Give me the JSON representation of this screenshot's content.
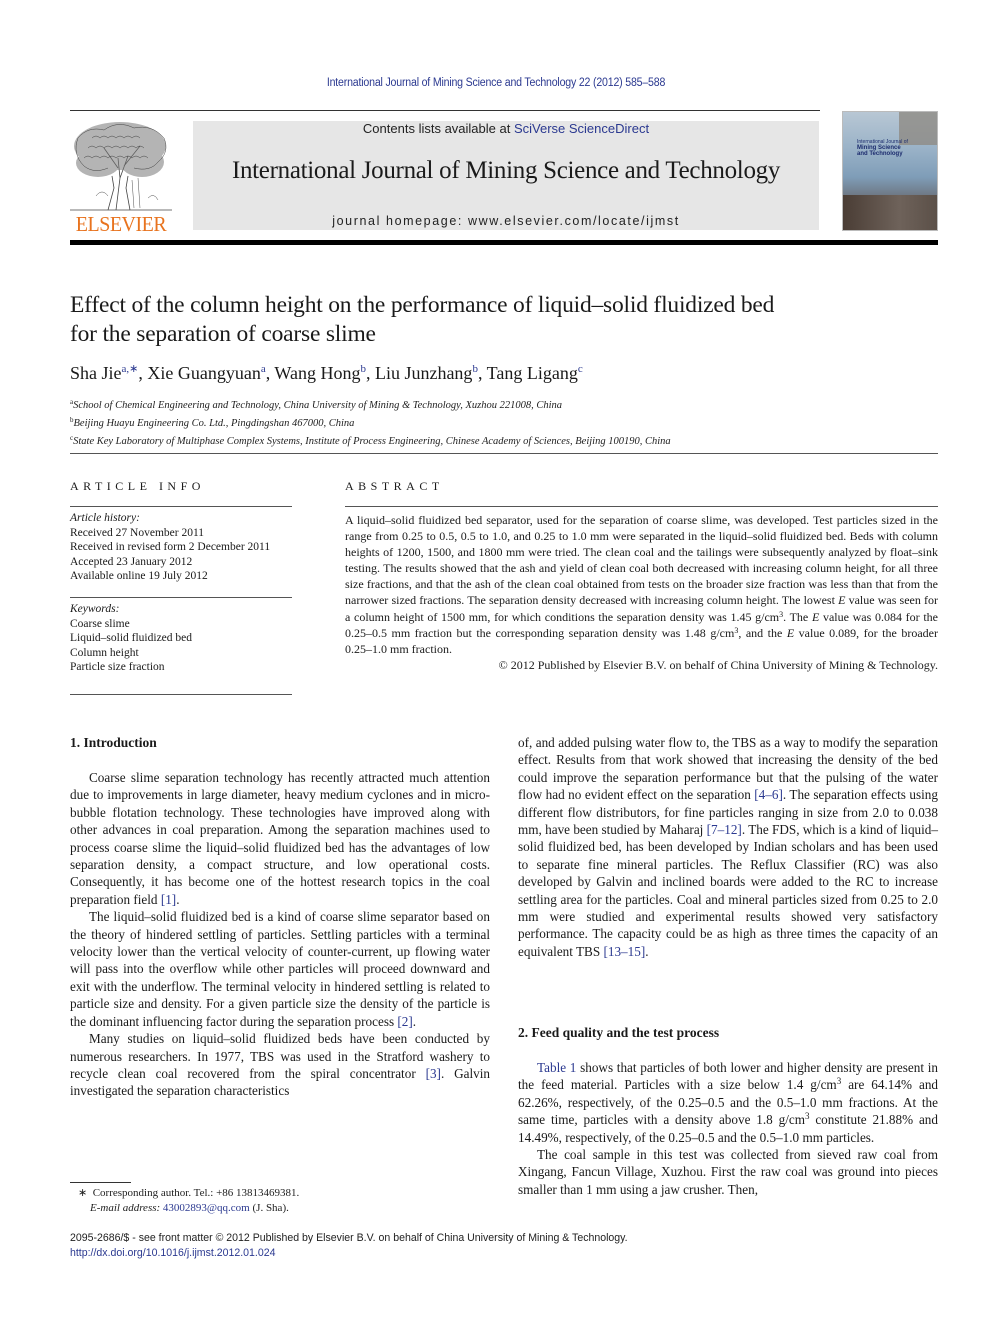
{
  "running_head": "International Journal of Mining Science and Technology 22 (2012) 585–588",
  "masthead": {
    "publisher_logo_text": "ELSEVIER",
    "contents_prefix": "Contents lists available at ",
    "contents_link": "SciVerse ScienceDirect",
    "journal_title": "International Journal of Mining Science and Technology",
    "homepage_prefix": "journal homepage: ",
    "homepage_url": "www.elsevier.com/locate/ijmst",
    "cover_title_lines": [
      "International Journal of",
      "Mining Science",
      "and Technology"
    ]
  },
  "article": {
    "title_line1": "Effect of the column height on the performance of liquid–solid fluidized bed",
    "title_line2": "for the separation of coarse slime",
    "authors": [
      {
        "name": "Sha Jie",
        "sup": "a,∗",
        "sep": ", "
      },
      {
        "name": "Xie Guangyuan",
        "sup": "a",
        "sep": ", "
      },
      {
        "name": "Wang Hong",
        "sup": "b",
        "sep": ", "
      },
      {
        "name": "Liu Junzhang",
        "sup": "b",
        "sep": ", "
      },
      {
        "name": "Tang Ligang",
        "sup": "c",
        "sep": ""
      }
    ],
    "affiliations": [
      {
        "mark": "a",
        "text": "School of Chemical Engineering and Technology, China University of Mining & Technology, Xuzhou 221008, China"
      },
      {
        "mark": "b",
        "text": "Beijing Huayu Engineering Co. Ltd., Pingdingshan 467000, China"
      },
      {
        "mark": "c",
        "text": "State Key Laboratory of Multiphase Complex Systems, Institute of Process Engineering, Chinese Academy of Sciences, Beijing 100190, China"
      }
    ]
  },
  "article_info": {
    "heading": "ARTICLE INFO",
    "history_label": "Article history:",
    "history": [
      "Received 27 November 2011",
      "Received in revised form 2 December 2011",
      "Accepted 23 January 2012",
      "Available online 19 July 2012"
    ],
    "keywords_label": "Keywords:",
    "keywords": [
      "Coarse slime",
      "Liquid–solid fluidized bed",
      "Column height",
      "Particle size fraction"
    ]
  },
  "abstract": {
    "heading": "ABSTRACT",
    "p1": "A liquid–solid fluidized bed separator, used for the separation of coarse slime, was developed. Test particles sized in the range from 0.25 to 0.5, 0.5 to 1.0, and 0.25 to 1.0 mm were separated in the liquid–solid fluidized bed. Beds with column heights of 1200, 1500, and 1800 mm were tried. The clean coal and the tailings were subsequently analyzed by float–sink testing. The results showed that the ash and yield of clean coal both decreased with increasing column height, for all three size fractions, and that the ash of the clean coal obtained from tests on the broader size fraction was less than that from the narrower sized fractions. The separation density decreased with increasing column height. The lowest ",
    "p2": " value was seen for a column height of 1500 mm, for which conditions the separation density was 1.45 g/cm",
    "p3": ". The ",
    "p4": " value was 0.084 for the 0.25–0.5 mm fraction but the corresponding separation density was 1.48 g/cm",
    "p5": ", and the ",
    "p6": " value 0.089, for the broader 0.25–1.0 mm fraction.",
    "e_symbol": "E",
    "cube": "3",
    "copyright": "© 2012 Published by Elsevier B.V. on behalf of China University of Mining & Technology."
  },
  "section1": {
    "heading": "1. Introduction",
    "p1_text": "Coarse slime separation technology has recently attracted much attention due to improvements in large diameter, heavy medium cyclones and in micro-bubble flotation technology. These technologies have improved along with other advances in coal preparation. Among the separation machines used to process coarse slime the liquid–solid fluidized bed has the advantages of low separation density, a compact structure, and low operational costs. Consequently, it has become one of the hottest research topics in the coal preparation field ",
    "p1_ref": "[1]",
    "p2_text": "The liquid–solid fluidized bed is a kind of coarse slime separator based on the theory of hindered settling of particles. Settling particles with a terminal velocity lower than the vertical velocity of counter-current, up flowing water will pass into the overflow while other particles will proceed downward and exit with the underflow. The terminal velocity in hindered settling is related to particle size and density. For a given particle size the density of the particle is the dominant influencing factor during the separation process ",
    "p2_ref": "[2]",
    "p3_text": "Many studies on liquid–solid fluidized beds have been conducted by numerous researchers. In 1977, TBS was used in the Stratford washery to recycle clean coal recovered from the spiral concentrator ",
    "p3_ref": "[3]",
    "p3_tail": ". Galvin investigated the separation characteristics",
    "col2_p1a": "of, and added pulsing water flow to, the TBS as a way to modify the separation effect. Results from that work showed that increasing the density of the bed could improve the separation performance but that the pulsing of the water flow had no evident effect on the separation ",
    "col2_ref1": "[4–6]",
    "col2_p1b": ". The separation effects using different flow distributors, for fine particles ranging in size from 2.0 to 0.038 mm, have been studied by Maharaj ",
    "col2_ref2": "[7–12]",
    "col2_p1c": ". The FDS, which is a kind of liquid–solid fluidized bed, has been developed by Indian scholars and has been used to separate fine mineral particles. The Reflux Classifier (RC) was also developed by Galvin and inclined boards were added to the RC to increase settling area for the particles. Coal and mineral particles sized from 0.25 to 2.0 mm were studied and experimental results showed very satisfactory performance. The capacity could be as high as three times the capacity of an equivalent TBS ",
    "col2_ref3": "[13–15]"
  },
  "section2": {
    "heading": "2. Feed quality and the test process",
    "p1_ref": "Table 1",
    "p1_a": " shows that particles of both lower and higher density are present in the feed material. Particles with a size below 1.4 g/cm",
    "p1_b": " are 64.14% and 62.26%, respectively, of the 0.25–0.5 and the 0.5–1.0 mm fractions. At the same time, particles with a density above 1.8 g/cm",
    "p1_c": " constitute 21.88% and 14.49%, respectively, of the 0.25–0.5 and the 0.5–1.0 mm particles.",
    "cube": "3",
    "p2": "The coal sample in this test was collected from sieved raw coal from Xingang, Fancun Village, Xuzhou. First the raw coal was ground into pieces smaller than 1 mm using a jaw crusher. Then,"
  },
  "footnote": {
    "mark": "∗",
    "corresponding": "Corresponding author. Tel.: +86 13813469381.",
    "email_label": "E-mail address:",
    "email": "43002893@qq.com",
    "email_suffix": " (J. Sha)."
  },
  "bottom": {
    "issn_line": "2095-2686/$ - see front matter © 2012 Published by Elsevier B.V. on behalf of China University of Mining & Technology.",
    "doi": "http://dx.doi.org/10.1016/j.ijmst.2012.01.024"
  },
  "colors": {
    "link": "#2b3990",
    "elsevier_orange": "#e8731e",
    "banner_bg": "#e6e6e6"
  }
}
